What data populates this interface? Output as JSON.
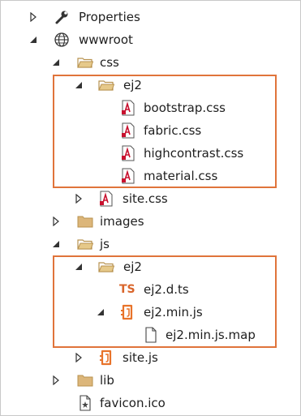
{
  "tree": {
    "properties": "Properties",
    "wwwroot": "wwwroot",
    "css": "css",
    "ej2_css": "ej2",
    "bootstrap": "bootstrap.css",
    "fabric": "fabric.css",
    "highcontrast": "highcontrast.css",
    "material": "material.css",
    "site_css": "site.css",
    "images": "images",
    "js": "js",
    "ej2_js": "ej2",
    "ej2_dts": "ej2.d.ts",
    "ts_badge": "TS",
    "ej2_min_js": "ej2.min.js",
    "ej2_min_map": "ej2.min.js.map",
    "site_js": "site.js",
    "lib": "lib",
    "favicon": "favicon.ico"
  },
  "colors": {
    "highlight_border": "#e0743b",
    "folder": "#dcb67a",
    "css_red": "#c8102e",
    "js_orange": "#e8732a",
    "ts_orange": "#d9652b"
  }
}
